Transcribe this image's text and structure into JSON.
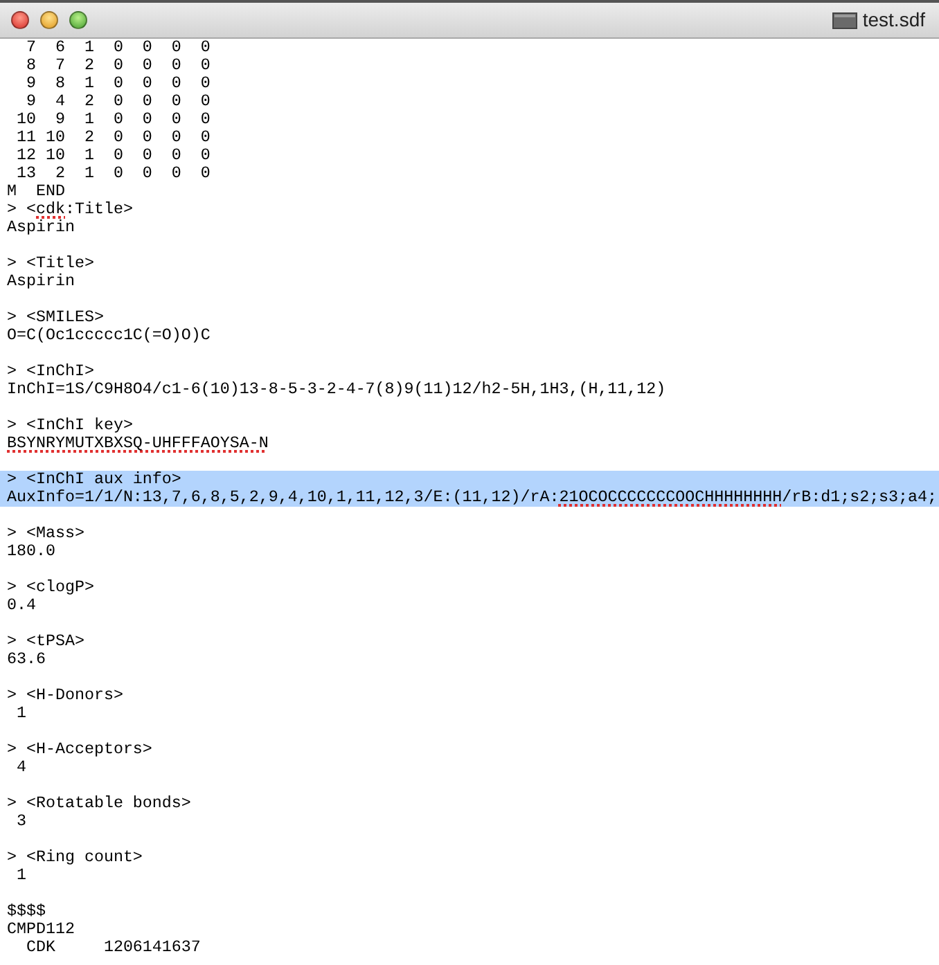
{
  "window": {
    "title": "test.sdf"
  },
  "lines": [
    {
      "text": "  7  6  1  0  0  0  0",
      "selected": false
    },
    {
      "text": "  8  7  2  0  0  0  0",
      "selected": false
    },
    {
      "text": "  9  8  1  0  0  0  0",
      "selected": false
    },
    {
      "text": "  9  4  2  0  0  0  0",
      "selected": false
    },
    {
      "text": " 10  9  1  0  0  0  0",
      "selected": false
    },
    {
      "text": " 11 10  2  0  0  0  0",
      "selected": false
    },
    {
      "text": " 12 10  1  0  0  0  0",
      "selected": false
    },
    {
      "text": " 13  2  1  0  0  0  0",
      "selected": false
    },
    {
      "text": "M  END",
      "selected": false
    },
    {
      "segments": [
        {
          "text": "> <"
        },
        {
          "text": "cdk",
          "misspelled": true
        },
        {
          "text": ":Title>"
        }
      ],
      "selected": false
    },
    {
      "text": "Aspirin",
      "selected": false
    },
    {
      "selected": false
    },
    {
      "text": "> <Title>",
      "selected": false
    },
    {
      "text": "Aspirin",
      "selected": false
    },
    {
      "selected": false
    },
    {
      "text": "> <SMILES>",
      "selected": false
    },
    {
      "text": "O=C(Oc1ccccc1C(=O)O)C",
      "selected": false
    },
    {
      "selected": false
    },
    {
      "text": "> <InChI>",
      "selected": false
    },
    {
      "text": "InChI=1S/C9H8O4/c1-6(10)13-8-5-3-2-4-7(8)9(11)12/h2-5H,1H3,(H,11,12)",
      "selected": false
    },
    {
      "selected": false
    },
    {
      "text": "> <InChI key>",
      "selected": false
    },
    {
      "segments": [
        {
          "text": "BSYNRYMUTXBXSQ-UHFFFAOYSA-N",
          "misspelled": true
        }
      ],
      "selected": false
    },
    {
      "selected": false
    },
    {
      "text": "> <InChI aux info>",
      "selected": true
    },
    {
      "segments": [
        {
          "text": "AuxInfo=1/1/N:13,7,6,8,5,2,9,4,10,1,11,12,3/E:(11,12)/rA:"
        },
        {
          "text": "21OCOCCCCCCCOOCHHHHHHHH",
          "misspelled": true
        },
        {
          "text": "/rB:d1;s2;s3;a4;"
        }
      ],
      "selected": true
    },
    {
      "selected": false
    },
    {
      "text": "> <Mass>",
      "selected": false
    },
    {
      "text": "180.0",
      "selected": false
    },
    {
      "selected": false
    },
    {
      "text": "> <clogP>",
      "selected": false
    },
    {
      "text": "0.4",
      "selected": false
    },
    {
      "selected": false
    },
    {
      "text": "> <tPSA>",
      "selected": false
    },
    {
      "text": "63.6",
      "selected": false
    },
    {
      "selected": false
    },
    {
      "text": "> <H-Donors>",
      "selected": false
    },
    {
      "text": " 1",
      "selected": false
    },
    {
      "selected": false
    },
    {
      "text": "> <H-Acceptors>",
      "selected": false
    },
    {
      "text": " 4",
      "selected": false
    },
    {
      "selected": false
    },
    {
      "text": "> <Rotatable bonds>",
      "selected": false
    },
    {
      "text": " 3",
      "selected": false
    },
    {
      "selected": false
    },
    {
      "text": "> <Ring count>",
      "selected": false
    },
    {
      "text": " 1",
      "selected": false
    },
    {
      "selected": false
    },
    {
      "text": "$$$$",
      "selected": false
    },
    {
      "text": "CMPD112",
      "selected": false
    },
    {
      "text": "  CDK     1206141637",
      "selected": false
    }
  ]
}
